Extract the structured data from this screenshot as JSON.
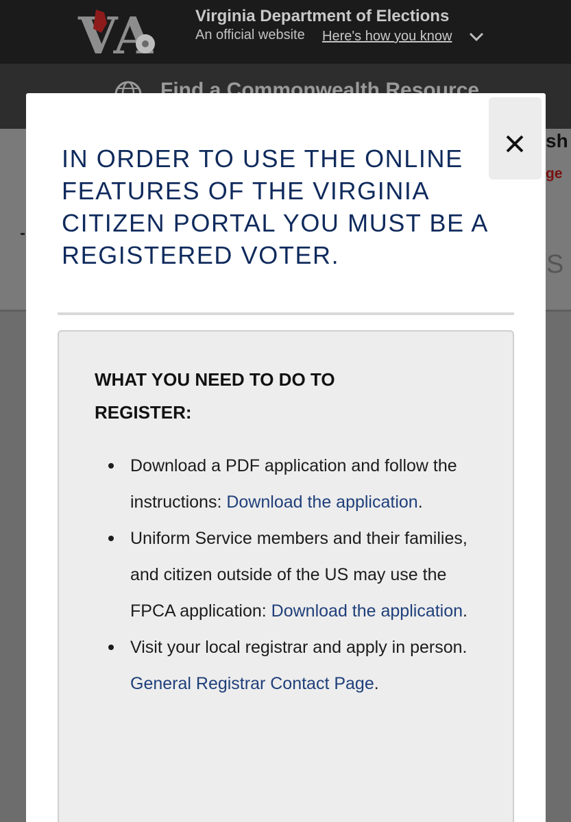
{
  "header": {
    "title": "Virginia Department of Elections",
    "official": "An official website",
    "how_know": "Here's how you know"
  },
  "resource_bar": {
    "label": "Find a Commonwealth Resource"
  },
  "background": {
    "partial_heading": "sh",
    "partial_link": "ge",
    "partial_letter": "S"
  },
  "modal": {
    "title": "IN ORDER TO USE THE ONLINE FEATURES OF THE VIRGINIA CITIZEN PORTAL YOU MUST BE A REGISTERED VOTER.",
    "close_icon": "close-icon",
    "panel": {
      "heading": "WHAT YOU NEED TO DO TO REGISTER:",
      "items": [
        {
          "text": "Download a PDF application and follow the instructions: ",
          "link": "Download the application",
          "after": "."
        },
        {
          "text": "Uniform Service members and their families, and citizen outside of the US may use the FPCA application: ",
          "link": "Download the application",
          "after": "."
        },
        {
          "text": "Visit your local registrar and apply in person. ",
          "link": "General Registrar Contact Page",
          "after": "."
        }
      ]
    }
  },
  "colors": {
    "title_navy": "#0f2a5c",
    "link_blue": "#1f3f7a",
    "header_bg": "#1b1b1b",
    "panel_bg": "#ededed"
  }
}
